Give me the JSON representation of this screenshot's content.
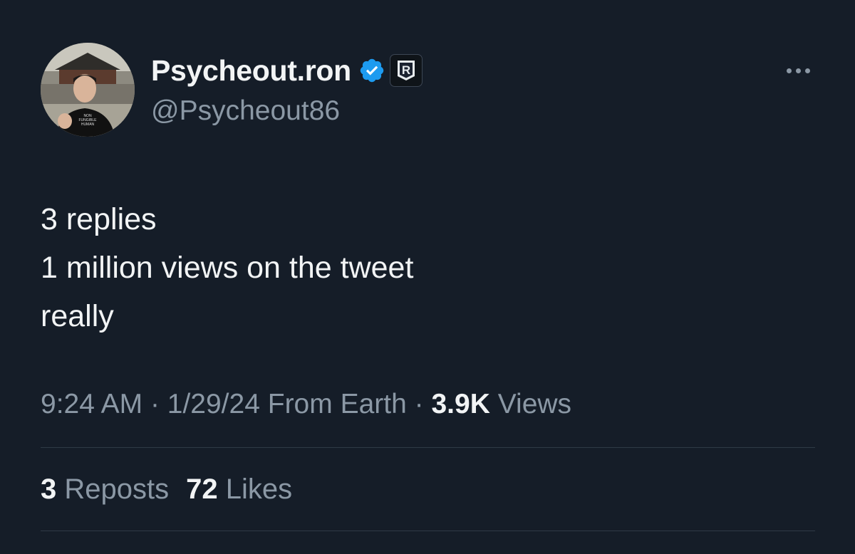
{
  "author": {
    "display_name": "Psycheout.ron",
    "handle": "@Psycheout86",
    "verified_icon": "verified-badge-icon",
    "affiliate_badge_letter": "R",
    "avatar_shirt_text": [
      "NON",
      "FUNGIBLE",
      "HUMAN"
    ]
  },
  "tweet": {
    "lines": [
      "3 replies",
      "1 million views on the tweet",
      "really"
    ]
  },
  "meta": {
    "time": "9:24 AM",
    "separator": "·",
    "date": "1/29/24",
    "location": "From Earth",
    "views_count": "3.9K",
    "views_label": "Views"
  },
  "stats": {
    "reposts_count": "3",
    "reposts_label": "Reposts",
    "likes_count": "72",
    "likes_label": "Likes"
  },
  "colors": {
    "background": "#151d28",
    "verified_blue": "#1d9bf0",
    "secondary_text": "#8b98a5",
    "primary_text": "#f2f4f5"
  }
}
